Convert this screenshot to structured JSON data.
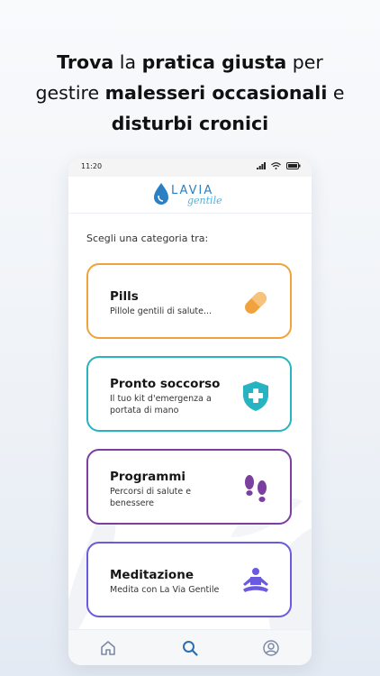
{
  "headline": {
    "line1_bold": "Trova",
    "line1_a": " la ",
    "line1_bold2": "pratica giusta",
    "line1_b": " per",
    "line2_a": "gestire ",
    "line2_bold": "malesseri occasionali",
    "line2_b": " e",
    "line3_bold": "disturbi cronici"
  },
  "status_bar": {
    "time": "11:20"
  },
  "logo": {
    "word": "LAVIA",
    "script": "gentile"
  },
  "prompt": "Scegli una categoria tra:",
  "categories": [
    {
      "title": "Pills",
      "subtitle": "Pillole gentili di salute...",
      "icon": "pill-icon",
      "color": "#f0a23c"
    },
    {
      "title": "Pronto soccorso",
      "subtitle": "Il tuo kit d'emergenza a portata di mano",
      "icon": "shield-cross-icon",
      "color": "#27b3c0"
    },
    {
      "title": "Programmi",
      "subtitle": "Percorsi di salute e benessere",
      "icon": "footprints-icon",
      "color": "#7b3fa0"
    },
    {
      "title": "Meditazione",
      "subtitle": "Medita con La Via Gentile",
      "icon": "meditation-icon",
      "color": "#6a5ae0"
    }
  ],
  "bottom_nav": [
    "home-icon",
    "search-icon",
    "profile-icon"
  ]
}
